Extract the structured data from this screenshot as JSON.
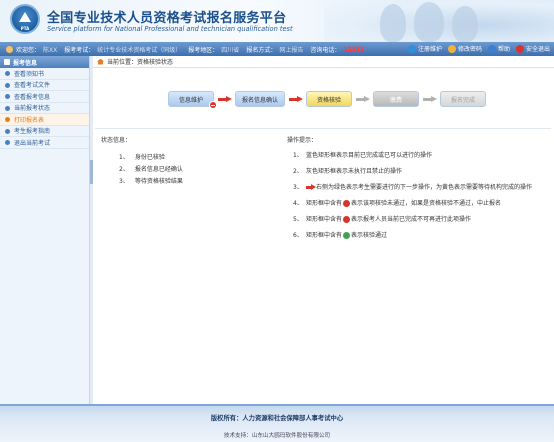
{
  "header": {
    "title_cn": "全国专业技术人员资格考试报名服务平台",
    "title_en": "Service platform for National Professional and technician qualification test",
    "logo_text": "PTA"
  },
  "infobar": {
    "welcome_label": "欢迎您：",
    "user_name": "陈XX",
    "exam_label": "报考考试：",
    "exam_value": "统计专业技术资格考试（同级）",
    "region_label": "报考地区：",
    "region_value": "四川省",
    "method_label": "报名方式：",
    "method_value": "网上报告",
    "phone_label": "咨询电话：",
    "phone_value": "12333",
    "links": [
      "注册维护",
      "修改密码",
      "帮助",
      "安全退出"
    ]
  },
  "sidebar": {
    "title": "报考信息",
    "items": [
      "查看须知书",
      "查看考试文件",
      "查看报考信息",
      "当前报考状态",
      "打印报名表",
      "考生报考指南",
      "退出当前考试"
    ],
    "active_index": 4
  },
  "main": {
    "breadcrumb": "当前位置：资格核验状态",
    "flow": {
      "steps": [
        "信息维护",
        "报名信息确认",
        "资格核验",
        "缴费",
        "报名完成"
      ]
    },
    "status": {
      "title": "状态信息：",
      "items": [
        {
          "num": "1、",
          "text": "身份已核验"
        },
        {
          "num": "2、",
          "text": "报名信息已经确认"
        },
        {
          "num": "3、",
          "text": "等待资格核验结果"
        }
      ]
    },
    "tips": {
      "title": "操作提示：",
      "items": [
        {
          "num": "1、",
          "text": "蓝色矩形框表示目前已完成或已可以进行的操作"
        },
        {
          "num": "2、",
          "text": "灰色矩形框表示未执行且禁止的操作"
        },
        {
          "num": "3、",
          "text": "右侧为绿色表示考生需要进行的下一步操作，为黄色表示需要等待机构完成的操作"
        },
        {
          "num": "4、",
          "text_a": "矩形框中含有",
          "text_b": "表示该项核验未通过，如果是资格核验不通过，中止报名"
        },
        {
          "num": "5、",
          "text_a": "矩形框中含有",
          "text_b": "表示报考人员当前已完成不可再进行此项操作"
        },
        {
          "num": "6、",
          "text_a": "矩形框中含有",
          "text_b": "表示核验通过"
        }
      ]
    }
  },
  "footer": {
    "copyright": "版权所有：人力资源和社会保障部人事考试中心",
    "support": "技术支持：山东山大鸥玛软件股份有限公司"
  }
}
